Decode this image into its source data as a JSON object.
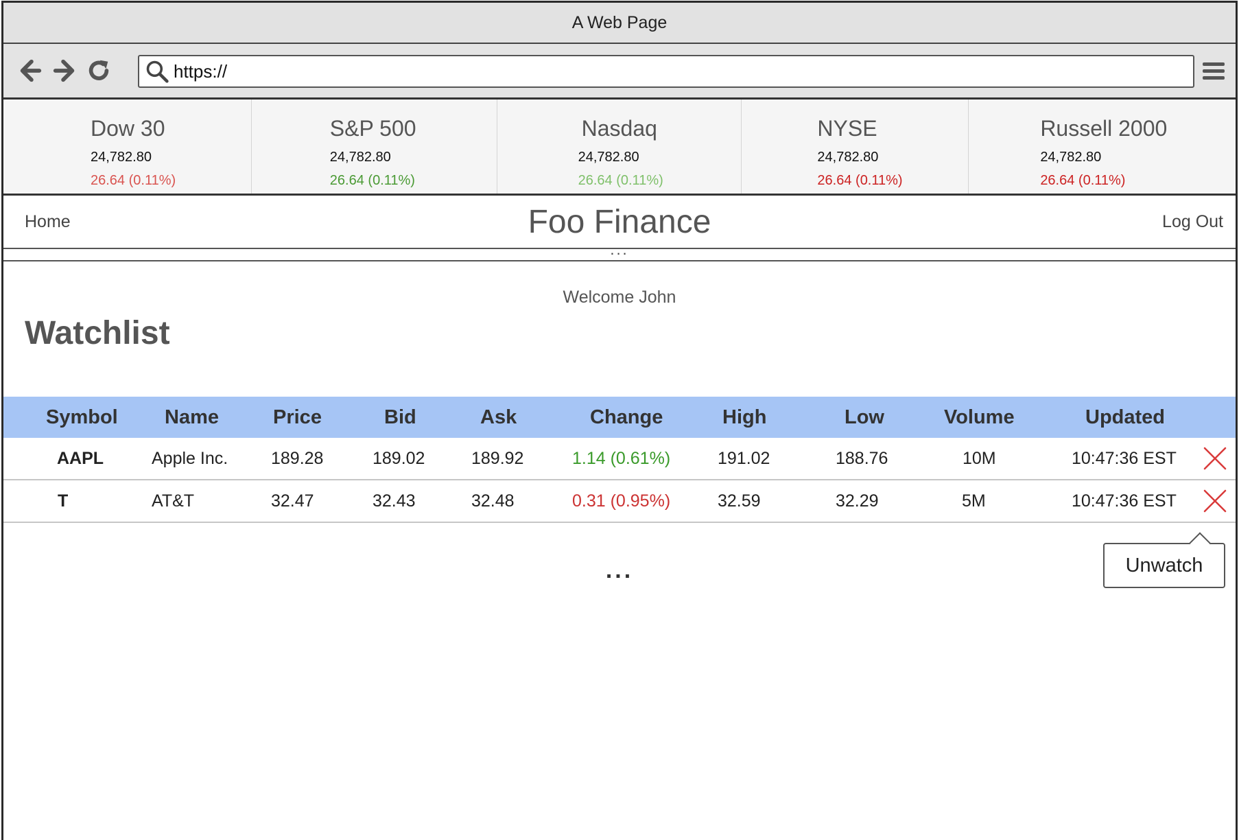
{
  "window": {
    "title": "A Web Page"
  },
  "toolbar": {
    "url": "https://"
  },
  "ticker": [
    {
      "name": "Dow 30",
      "value": "24,782.80",
      "change": "26.64 (0.11%)",
      "color": "#d9534f"
    },
    {
      "name": "S&P 500",
      "value": "24,782.80",
      "change": "26.64 (0.11%)",
      "color": "#4a9a34"
    },
    {
      "name": "Nasdaq",
      "value": "24,782.80",
      "change": "26.64 (0.11%)",
      "color": "#7fc06a"
    },
    {
      "name": "NYSE",
      "value": "24,782.80",
      "change": "26.64 (0.11%)",
      "color": "#cc2222"
    },
    {
      "name": "Russell 2000",
      "value": "24,782.80",
      "change": "26.64 (0.11%)",
      "color": "#cc2222"
    }
  ],
  "nav": {
    "home": "Home",
    "brand": "Foo Finance",
    "logout": "Log Out",
    "ellipsis": "..."
  },
  "main": {
    "welcome": "Welcome John",
    "title": "Watchlist",
    "more": "..."
  },
  "table": {
    "headers": [
      "Symbol",
      "Name",
      "Price",
      "Bid",
      "Ask",
      "Change",
      "High",
      "Low",
      "Volume",
      "Updated"
    ],
    "rows": [
      {
        "symbol": "AAPL",
        "name": "Apple Inc.",
        "price": "189.28",
        "bid": "189.02",
        "ask": "189.92",
        "change": "1.14 (0.61%)",
        "direction": "up",
        "high": "191.02",
        "low": "188.76",
        "volume": "10M",
        "updated": "10:47:36 EST"
      },
      {
        "symbol": "T",
        "name": "AT&T",
        "price": "32.47",
        "bid": "32.43",
        "ask": "32.48",
        "change": "0.31 (0.95%)",
        "direction": "down",
        "high": "32.59",
        "low": "32.29",
        "volume": "5M",
        "updated": "10:47:36 EST"
      }
    ]
  },
  "tooltip": {
    "label": "Unwatch"
  },
  "icons": {
    "back": "arrow-left-icon",
    "forward": "arrow-right-icon",
    "reload": "reload-icon",
    "search": "search-icon",
    "menu": "hamburger-menu-icon",
    "remove": "close-x-icon"
  },
  "colors": {
    "header_bg": "#a6c5f5",
    "positive": "#3a9a2a",
    "negative": "#cc3333",
    "remove_x": "#d93a3a"
  }
}
